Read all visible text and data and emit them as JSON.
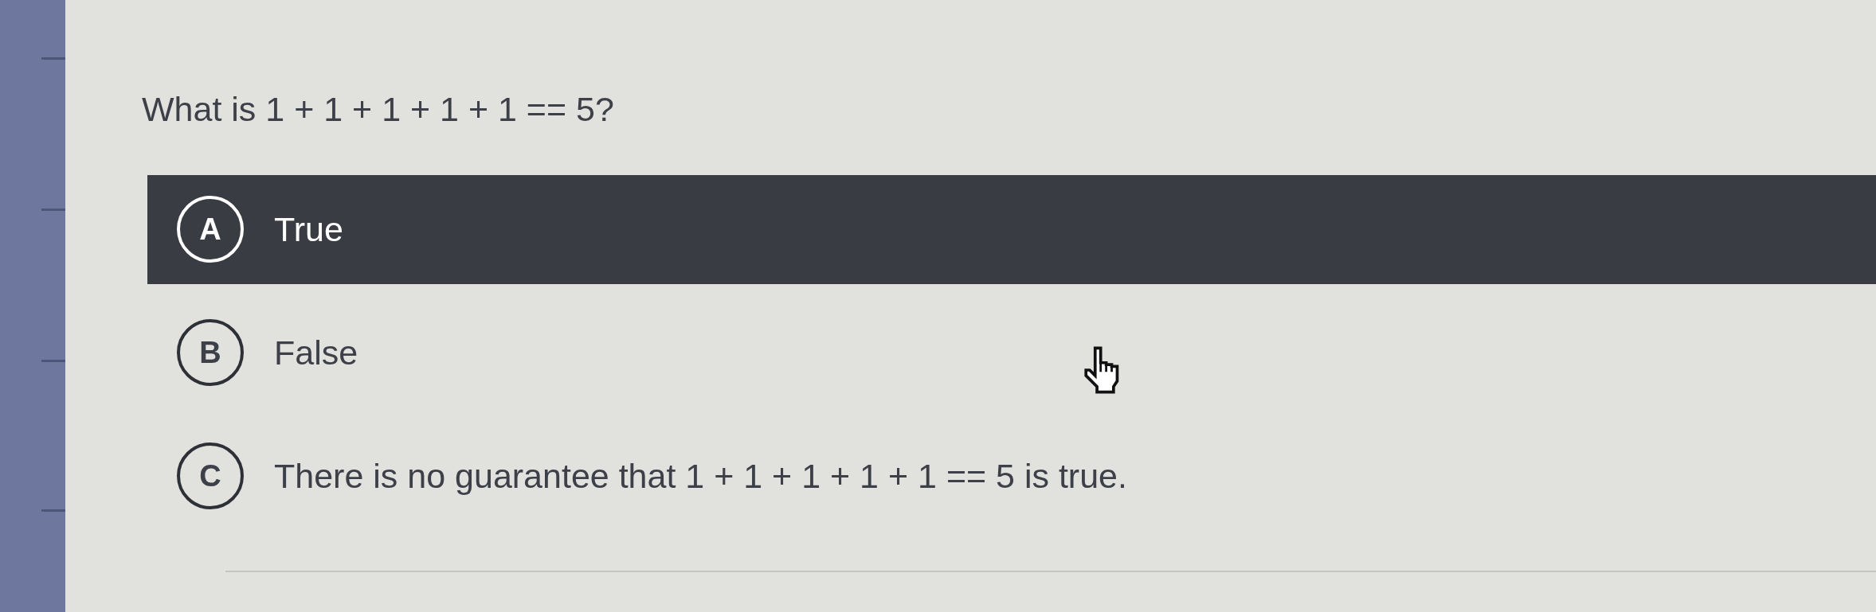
{
  "question": {
    "text": "What is 1 + 1 + 1 + 1 + 1 == 5?"
  },
  "options": [
    {
      "letter": "A",
      "text": "True",
      "selected": true
    },
    {
      "letter": "B",
      "text": "False",
      "selected": false
    },
    {
      "letter": "C",
      "text": "There is no guarantee that 1 + 1 + 1 + 1 + 1 == 5 is true.",
      "selected": false
    }
  ]
}
